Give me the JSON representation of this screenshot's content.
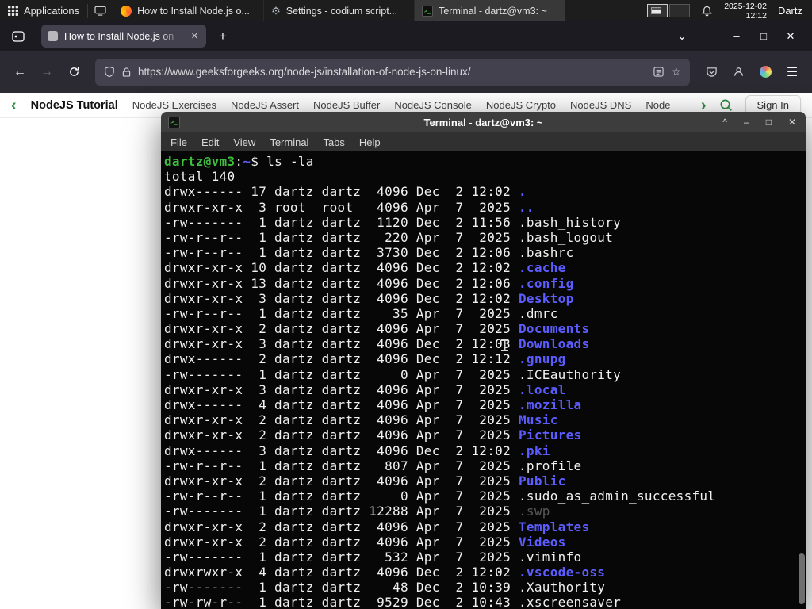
{
  "panel": {
    "applications_label": "Applications",
    "windows": [
      {
        "title": "How to Install Node.js o..."
      },
      {
        "title": "Settings - codium script..."
      },
      {
        "title": "Terminal - dartz@vm3: ~"
      }
    ],
    "clock": {
      "date": "2025-12-02",
      "time": "12:12"
    },
    "user": "Dartz"
  },
  "browser": {
    "tab_title": "How to Install Node.js on",
    "url": "https://www.geeksforgeeks.org/node-js/installation-of-node-js-on-linux/",
    "glyphs": {
      "back": "←",
      "forward": "→",
      "new_tab": "+",
      "tab_close": "✕",
      "tab_overflow": "⌄",
      "menu_button": "☰",
      "star": "☆",
      "minimize": "–",
      "maximize": "□",
      "close": "✕"
    }
  },
  "site_nav": {
    "back_chevron": "‹",
    "primary": "NodeJS Tutorial",
    "items": [
      "NodeJS Exercises",
      "NodeJS Assert",
      "NodeJS Buffer",
      "NodeJS Console",
      "NodeJS Crypto",
      "NodeJS DNS",
      "Node"
    ],
    "forward_chevron": "›",
    "sign_in_label": "Sign In"
  },
  "terminal": {
    "title": "Terminal - dartz@vm3: ~",
    "menu": [
      "File",
      "Edit",
      "View",
      "Terminal",
      "Tabs",
      "Help"
    ],
    "controls": {
      "shade": "^",
      "minimize": "–",
      "maximize": "□",
      "close": "✕"
    },
    "lines": [
      [
        [
          "dartz@vm3",
          "green"
        ],
        [
          ":",
          "fg"
        ],
        [
          "~",
          "blue"
        ],
        [
          "$ ls -la",
          "fg"
        ]
      ],
      [
        [
          "total 140",
          "fg"
        ]
      ],
      [
        [
          "drwx------ 17 dartz dartz  4096 Dec  2 12:02 ",
          "fg"
        ],
        [
          ".",
          "blue"
        ]
      ],
      [
        [
          "drwxr-xr-x  3 root  root   4096 Apr  7  2025 ",
          "fg"
        ],
        [
          "..",
          "blue"
        ]
      ],
      [
        [
          "-rw-------  1 dartz dartz  1120 Dec  2 11:56 .bash_history",
          "fg"
        ]
      ],
      [
        [
          "-rw-r--r--  1 dartz dartz   220 Apr  7  2025 .bash_logout",
          "fg"
        ]
      ],
      [
        [
          "-rw-r--r--  1 dartz dartz  3730 Dec  2 12:06 .bashrc",
          "fg"
        ]
      ],
      [
        [
          "drwxr-xr-x 10 dartz dartz  4096 Dec  2 12:02 ",
          "fg"
        ],
        [
          ".cache",
          "blue"
        ]
      ],
      [
        [
          "drwxr-xr-x 13 dartz dartz  4096 Dec  2 12:06 ",
          "fg"
        ],
        [
          ".config",
          "blue"
        ]
      ],
      [
        [
          "drwxr-xr-x  3 dartz dartz  4096 Dec  2 12:02 ",
          "fg"
        ],
        [
          "Desktop",
          "blue"
        ]
      ],
      [
        [
          "-rw-r--r--  1 dartz dartz    35 Apr  7  2025 .dmrc",
          "fg"
        ]
      ],
      [
        [
          "drwxr-xr-x  2 dartz dartz  4096 Apr  7  2025 ",
          "fg"
        ],
        [
          "Documents",
          "blue"
        ]
      ],
      [
        [
          "drwxr-xr-x  3 dartz dartz  4096 Dec  2 12:03 ",
          "fg"
        ],
        [
          "Downloads",
          "blue"
        ]
      ],
      [
        [
          "drwx------  2 dartz dartz  4096 Dec  2 12:12 ",
          "fg"
        ],
        [
          ".gnupg",
          "blue"
        ]
      ],
      [
        [
          "-rw-------  1 dartz dartz     0 Apr  7  2025 .ICEauthority",
          "fg"
        ]
      ],
      [
        [
          "drwxr-xr-x  3 dartz dartz  4096 Apr  7  2025 ",
          "fg"
        ],
        [
          ".local",
          "blue"
        ]
      ],
      [
        [
          "drwx------  4 dartz dartz  4096 Apr  7  2025 ",
          "fg"
        ],
        [
          ".mozilla",
          "blue"
        ]
      ],
      [
        [
          "drwxr-xr-x  2 dartz dartz  4096 Apr  7  2025 ",
          "fg"
        ],
        [
          "Music",
          "blue"
        ]
      ],
      [
        [
          "drwxr-xr-x  2 dartz dartz  4096 Apr  7  2025 ",
          "fg"
        ],
        [
          "Pictures",
          "blue"
        ]
      ],
      [
        [
          "drwx------  3 dartz dartz  4096 Dec  2 12:02 ",
          "fg"
        ],
        [
          ".pki",
          "blue"
        ]
      ],
      [
        [
          "-rw-r--r--  1 dartz dartz   807 Apr  7  2025 .profile",
          "fg"
        ]
      ],
      [
        [
          "drwxr-xr-x  2 dartz dartz  4096 Apr  7  2025 ",
          "fg"
        ],
        [
          "Public",
          "blue"
        ]
      ],
      [
        [
          "-rw-r--r--  1 dartz dartz     0 Apr  7  2025 .sudo_as_admin_successful",
          "fg"
        ]
      ],
      [
        [
          "-rw-------  1 dartz dartz 12288 Apr  7  2025 ",
          "fg"
        ],
        [
          ".swp",
          "dim"
        ]
      ],
      [
        [
          "drwxr-xr-x  2 dartz dartz  4096 Apr  7  2025 ",
          "fg"
        ],
        [
          "Templates",
          "blue"
        ]
      ],
      [
        [
          "drwxr-xr-x  2 dartz dartz  4096 Apr  7  2025 ",
          "fg"
        ],
        [
          "Videos",
          "blue"
        ]
      ],
      [
        [
          "-rw-------  1 dartz dartz   532 Apr  7  2025 .viminfo",
          "fg"
        ]
      ],
      [
        [
          "drwxrwxr-x  4 dartz dartz  4096 Dec  2 12:02 ",
          "fg"
        ],
        [
          ".vscode-oss",
          "blue"
        ]
      ],
      [
        [
          "-rw-------  1 dartz dartz    48 Dec  2 10:39 .Xauthority",
          "fg"
        ]
      ],
      [
        [
          "-rw-rw-r--  1 dartz dartz  9529 Dec  2 10:43 .xscreensaver",
          "fg"
        ]
      ]
    ]
  },
  "colors": {
    "gfg_green": "#2F8D46",
    "dir_blue": "#5C5CFF",
    "prompt_green": "#3FBD3F",
    "term_bg": "#070707"
  }
}
